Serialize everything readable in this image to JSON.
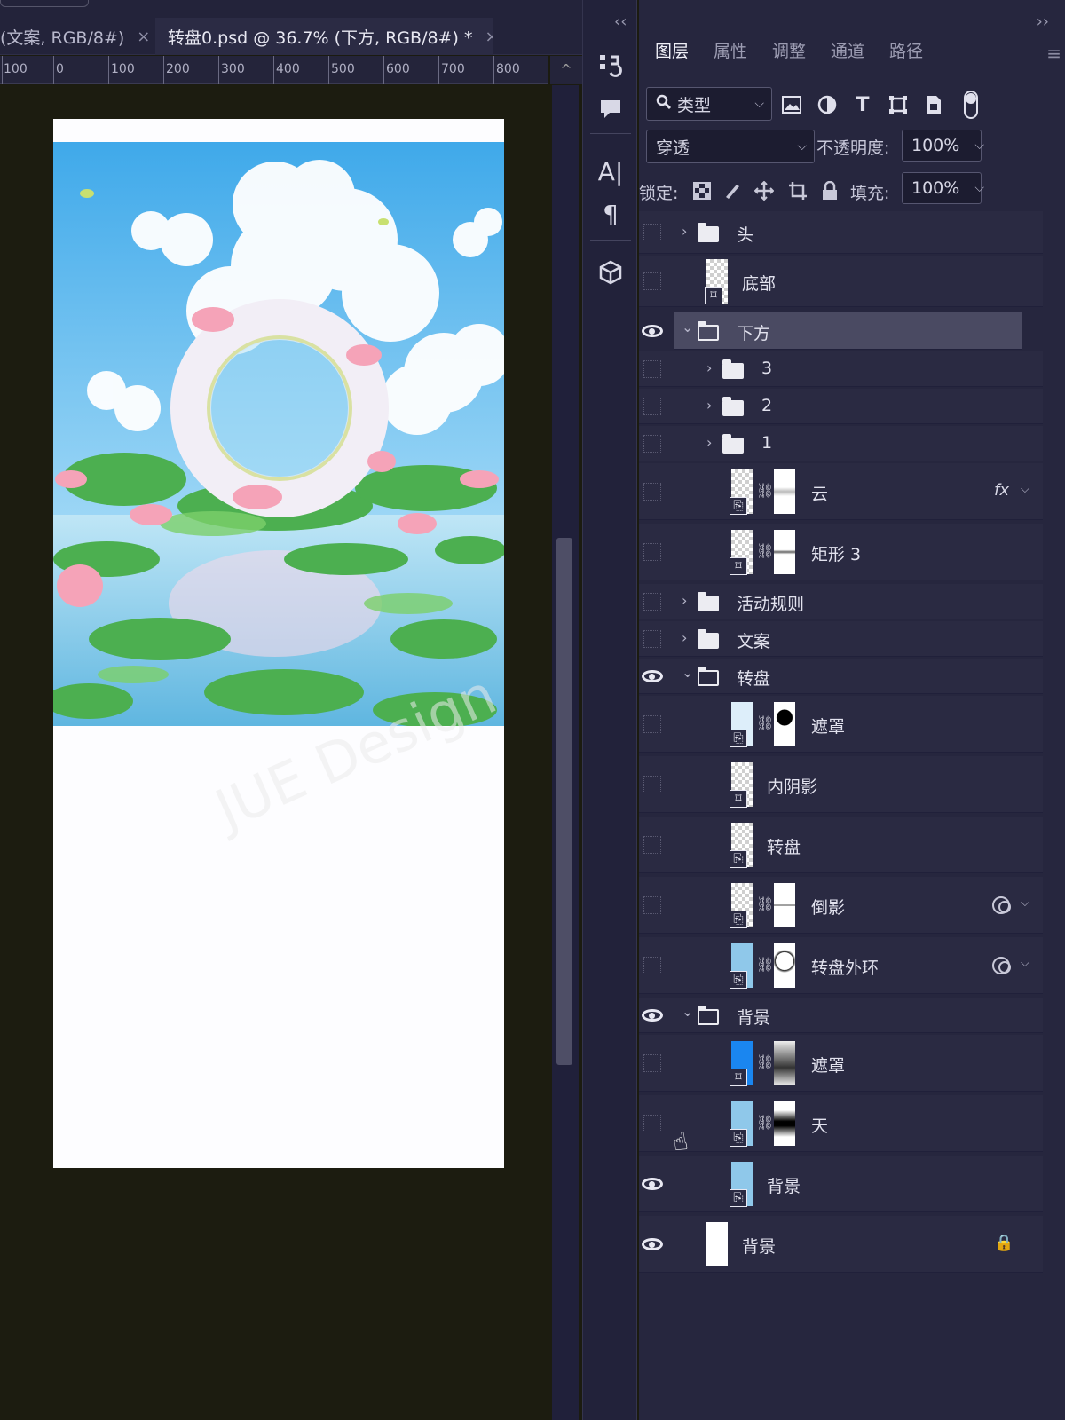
{
  "tabs": [
    {
      "label": "(文案, RGB/8#)",
      "close": "×"
    },
    {
      "label": "转盘0.psd @ 36.7% (下方, RGB/8#) *",
      "close": "×"
    }
  ],
  "ruler": {
    "labels": [
      "100",
      "0",
      "100",
      "200",
      "300",
      "400",
      "500",
      "600",
      "700",
      "800"
    ],
    "corner": "^"
  },
  "canvas": {
    "watermark": "JUE Design"
  },
  "panel": {
    "collapse_left": "‹‹",
    "collapse_right": "››",
    "tabs": [
      "图层",
      "属性",
      "调整",
      "通道",
      "路径"
    ],
    "active_tab": "图层",
    "menu": "≡",
    "filter_type": "类型",
    "blend_mode": "穿透",
    "opacity_label": "不透明度:",
    "opacity_value": "100%",
    "lock_label": "锁定:",
    "fill_label": "填充:",
    "fill_value": "100%"
  },
  "layers": [
    {
      "name": "头",
      "kind": "group",
      "visible": false,
      "indent": 0,
      "expanded": false
    },
    {
      "name": "底部",
      "kind": "layer",
      "visible": false,
      "indent": 0
    },
    {
      "name": "下方",
      "kind": "group",
      "visible": true,
      "indent": 0,
      "expanded": true,
      "selected": true
    },
    {
      "name": "3",
      "kind": "group",
      "visible": false,
      "indent": 1,
      "expanded": false
    },
    {
      "name": "2",
      "kind": "group",
      "visible": false,
      "indent": 1,
      "expanded": false
    },
    {
      "name": "1",
      "kind": "group",
      "visible": false,
      "indent": 1,
      "expanded": false
    },
    {
      "name": "云",
      "kind": "masked",
      "visible": false,
      "indent": 1,
      "fx": "fx"
    },
    {
      "name": "矩形 3",
      "kind": "masked",
      "visible": false,
      "indent": 1
    },
    {
      "name": "活动规则",
      "kind": "group",
      "visible": false,
      "indent": 0,
      "expanded": false
    },
    {
      "name": "文案",
      "kind": "group",
      "visible": false,
      "indent": 0,
      "expanded": false
    },
    {
      "name": "转盘",
      "kind": "group",
      "visible": true,
      "indent": 0,
      "expanded": true
    },
    {
      "name": "遮罩",
      "kind": "masked",
      "visible": false,
      "indent": 1
    },
    {
      "name": "内阴影",
      "kind": "layer",
      "visible": false,
      "indent": 1
    },
    {
      "name": "转盘",
      "kind": "layer",
      "visible": false,
      "indent": 1
    },
    {
      "name": "倒影",
      "kind": "masked",
      "visible": false,
      "indent": 1,
      "linked": true
    },
    {
      "name": "转盘外环",
      "kind": "masked",
      "visible": false,
      "indent": 1,
      "linked": true
    },
    {
      "name": "背景",
      "kind": "group",
      "visible": true,
      "indent": 0,
      "expanded": true
    },
    {
      "name": "遮罩",
      "kind": "masked",
      "visible": false,
      "indent": 1
    },
    {
      "name": "天",
      "kind": "masked",
      "visible": false,
      "indent": 1
    },
    {
      "name": "背景",
      "kind": "layer",
      "visible": true,
      "indent": 1
    },
    {
      "name": "背景",
      "kind": "background",
      "visible": true,
      "indent": 0,
      "locked": true
    }
  ]
}
